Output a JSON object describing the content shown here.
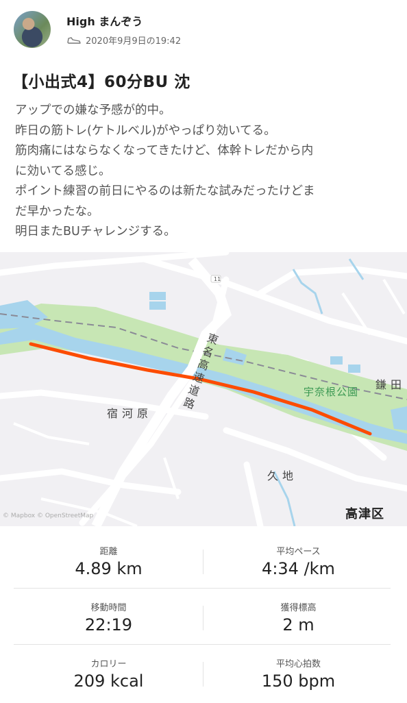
{
  "header": {
    "username": "High まんぞう",
    "timestamp": "2020年9月9日の19:42",
    "activity_icon": "shoe-icon"
  },
  "activity": {
    "title": "【小出式4】60分BU 沈",
    "description": [
      "アップでの嫌な予感が的中。",
      "昨日の筋トレ(ケトルベル)がやっぱり効いてる。",
      "筋肉痛にはならなくなってきたけど、体幹トレだから内",
      "に効いてる感じ。",
      "ポイント練習の前日にやるのは新たな試みだったけどま",
      "だ早かったな。",
      "明日またBUチャレンジする。"
    ]
  },
  "map": {
    "labels": {
      "highway": "東名高速道路",
      "shukugawara": "宿河原",
      "park": "宇奈根公園",
      "kamata": "鎌田",
      "kuji": "久地",
      "ward": "高津区",
      "route_number": "11"
    },
    "attribution": "© Mapbox © OpenStreetMap",
    "colors": {
      "route": "#fc4c02",
      "park": "#c7e6b4",
      "river": "#a7d4ec"
    }
  },
  "stats": {
    "distance": {
      "label": "距離",
      "value": "4.89 km"
    },
    "pace": {
      "label": "平均ペース",
      "value": "4:34 /km"
    },
    "moving_time": {
      "label": "移動時間",
      "value": "22:19"
    },
    "elevation": {
      "label": "獲得標高",
      "value": "2 m"
    },
    "calories": {
      "label": "カロリー",
      "value": "209 kcal"
    },
    "heart_rate": {
      "label": "平均心拍数",
      "value": "150 bpm"
    }
  }
}
